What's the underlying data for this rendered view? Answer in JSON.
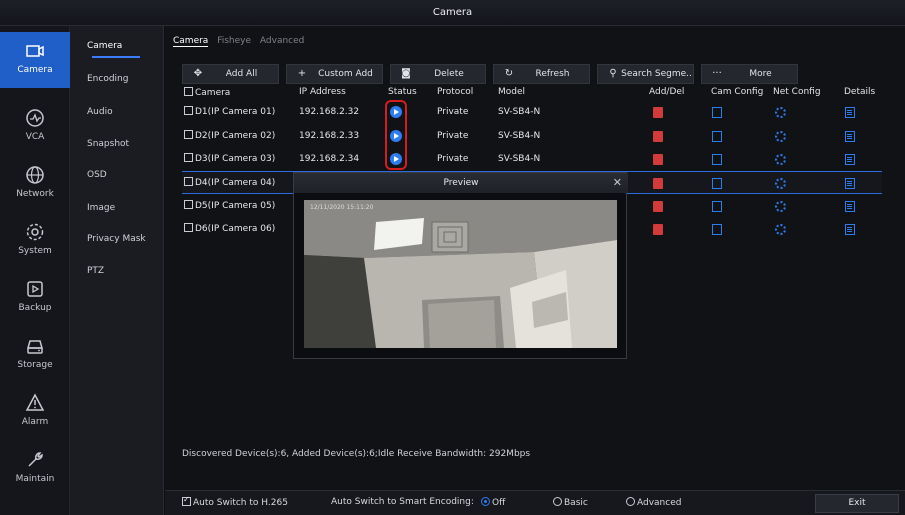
{
  "window": {
    "title": "Camera"
  },
  "rail": [
    {
      "label": "Camera",
      "icon": "camera-icon",
      "active": true
    },
    {
      "label": "VCA",
      "icon": "vca-icon"
    },
    {
      "label": "Network",
      "icon": "globe-icon"
    },
    {
      "label": "System",
      "icon": "gear-icon"
    },
    {
      "label": "Backup",
      "icon": "backup-icon"
    },
    {
      "label": "Storage",
      "icon": "storage-icon"
    },
    {
      "label": "Alarm",
      "icon": "alarm-icon"
    },
    {
      "label": "Maintain",
      "icon": "wrench-icon"
    }
  ],
  "submenu": [
    "Camera",
    "Encoding",
    "Audio",
    "Snapshot",
    "OSD",
    "Image",
    "Privacy Mask",
    "PTZ"
  ],
  "tabs": [
    "Camera",
    "Fisheye",
    "Advanced"
  ],
  "toolbar": {
    "add_all": "Add All",
    "custom_add": "Custom Add",
    "delete": "Delete",
    "refresh": "Refresh",
    "search": "Search Segme..",
    "more_dots": "···",
    "more": "More"
  },
  "columns": {
    "camera": "Camera",
    "ip": "IP Address",
    "status": "Status",
    "protocol": "Protocol",
    "model": "Model",
    "adddel": "Add/Del",
    "camconfig": "Cam Config",
    "netconfig": "Net Config",
    "details": "Details"
  },
  "cameras": [
    {
      "name": "D1(IP Camera 01)",
      "ip": "192.168.2.32",
      "protocol": "Private",
      "model": "SV-SB4-N"
    },
    {
      "name": "D2(IP Camera 02)",
      "ip": "192.168.2.33",
      "protocol": "Private",
      "model": "SV-SB4-N"
    },
    {
      "name": "D3(IP Camera 03)",
      "ip": "192.168.2.34",
      "protocol": "Private",
      "model": "SV-SB4-N"
    },
    {
      "name": "D4(IP Camera 04)"
    },
    {
      "name": "D5(IP Camera 05)"
    },
    {
      "name": "D6(IP Camera 06)"
    }
  ],
  "preview": {
    "title": "Preview",
    "close": "✕",
    "timestamp": "12/11/2020 15:11:20"
  },
  "discovered": "Discovered Device(s):6, Added Device(s):6;Idle Receive Bandwidth: 292Mbps",
  "bottom": {
    "auto_h265": "Auto Switch to H.265",
    "smart_label": "Auto Switch to Smart Encoding:",
    "off": "Off",
    "basic": "Basic",
    "advanced": "Advanced",
    "exit": "Exit"
  },
  "colors": {
    "accent": "#1f5fc7",
    "status_blue": "#2d7df0",
    "delete_red": "#d23b3b",
    "highlight": "#d41e1e"
  }
}
